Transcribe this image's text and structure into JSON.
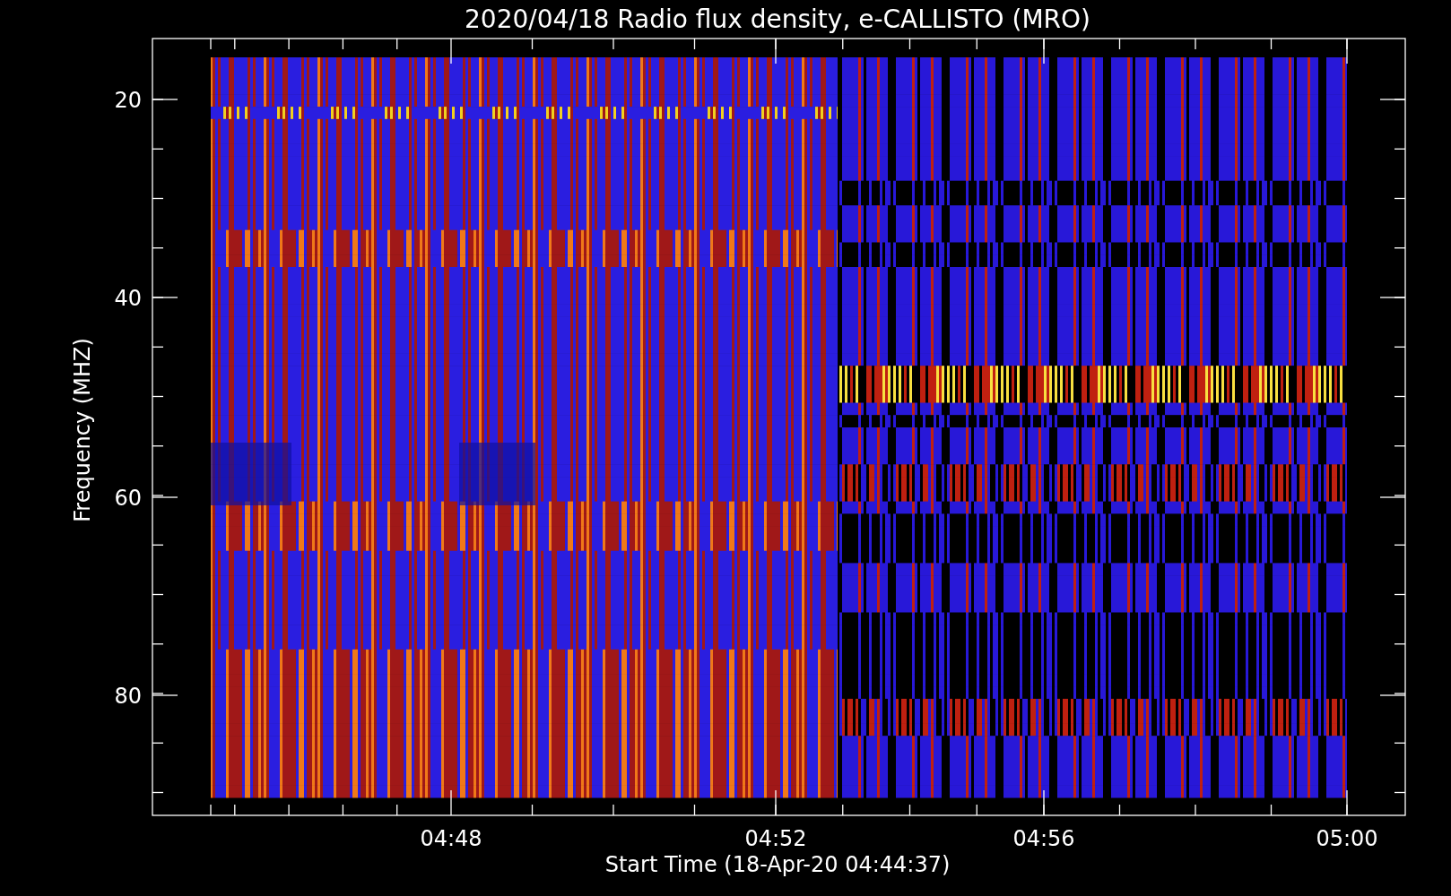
{
  "title": "2020/04/18  Radio flux density, e-CALLISTO (MRO)",
  "y_axis": {
    "label": "Frequency (MHZ)",
    "ticks": [
      "20",
      "40",
      "60",
      "80"
    ]
  },
  "x_axis": {
    "label": "Start Time (18-Apr-20 04:44:37)",
    "ticks": [
      "04:48",
      "04:52",
      "04:56",
      "05:00"
    ]
  }
}
